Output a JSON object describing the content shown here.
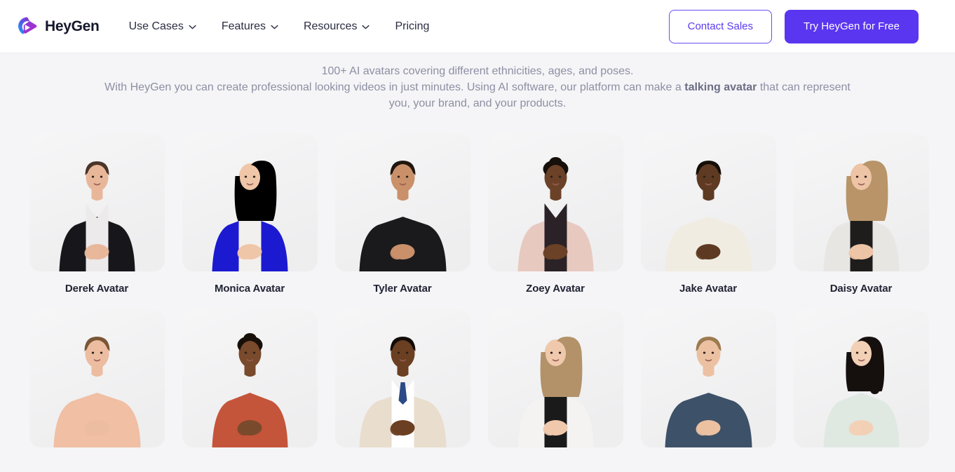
{
  "header": {
    "brand": {
      "name": "HeyGen",
      "logo_icon": "heygen-play-logo",
      "gradient_from": "#2f8bf5",
      "gradient_to": "#8b2bd6"
    },
    "nav": [
      {
        "label": "Use Cases",
        "has_dropdown": true,
        "icon": "chevron-down-icon"
      },
      {
        "label": "Features",
        "has_dropdown": true,
        "icon": "chevron-down-icon"
      },
      {
        "label": "Resources",
        "has_dropdown": true,
        "icon": "chevron-down-icon"
      },
      {
        "label": "Pricing",
        "has_dropdown": false
      }
    ],
    "actions": {
      "contact_sales": "Contact Sales",
      "try_free": "Try HeyGen for Free",
      "accent_color": "#5b36f0"
    }
  },
  "intro": {
    "line1": "100+ AI avatars covering different ethnicities, ages, and poses.",
    "line2_part1": "With HeyGen you can create professional looking videos in just minutes. Using AI software, our platform can make a ",
    "line2_bold": "talking avatar",
    "line2_part2": " that can represent you, your brand, and your products."
  },
  "avatars": [
    {
      "name": "Derek Avatar",
      "skin": "#e8b79a",
      "hair": "#4a3528",
      "outfit": "#17171b",
      "shirt": "#eceaea",
      "bg": "#f0f0f1",
      "hair_style": "short",
      "build": "slim"
    },
    {
      "name": "Monica Avatar",
      "skin": "#f0c6a8",
      "hair": "#c9a濃",
      "outfit": "#1c1ad0",
      "shirt": "#f2f0ee",
      "bg": "#f0f0f1",
      "hair_style": "long",
      "build": "slim"
    },
    {
      "name": "Tyler Avatar",
      "skin": "#c9906a",
      "hair": "#20160f",
      "outfit": "#1a1a1c",
      "shirt": "#1a1a1c",
      "bg": "#f0f0f1",
      "hair_style": "short",
      "build": "broad"
    },
    {
      "name": "Zoey Avatar",
      "skin": "#6b4228",
      "hair": "#160f0a",
      "outfit": "#e8c9c0",
      "shirt": "#2a2226",
      "bg": "#f0f0f1",
      "hair_style": "updo",
      "build": "slim"
    },
    {
      "name": "Jake Avatar",
      "skin": "#5e3a22",
      "hair": "#150e09",
      "outfit": "#f0ece2",
      "shirt": "#f0ece2",
      "bg": "#f0f0f1",
      "hair_style": "short",
      "build": "broad"
    },
    {
      "name": "Daisy Avatar",
      "skin": "#eec4a6",
      "hair": "#b89468",
      "outfit": "#e8e6e3",
      "shirt": "#1f1d1c",
      "bg": "#f0f0f1",
      "hair_style": "long",
      "build": "slim"
    },
    {
      "name": "",
      "skin": "#ecbda0",
      "hair": "#7a5636",
      "outfit": "#f0bfa4",
      "shirt": "#f0bfa4",
      "bg": "#f0f0f1",
      "hair_style": "short",
      "build": "broad"
    },
    {
      "name": "",
      "skin": "#7a4a2c",
      "hair": "#17100a",
      "outfit": "#c4553a",
      "shirt": "#c4553a",
      "bg": "#f0f0f1",
      "hair_style": "updo",
      "build": "slim"
    },
    {
      "name": "",
      "skin": "#6b3f22",
      "hair": "#120c08",
      "outfit": "#e9ddcd",
      "shirt": "#ffffff",
      "bg": "#f0f0f1",
      "hair_style": "short",
      "build": "broad",
      "tie": "#2b4a86"
    },
    {
      "name": "",
      "skin": "#f0c9ad",
      "hair": "#b3926a",
      "outfit": "#f4f3f1",
      "shirt": "#1a1a1a",
      "bg": "#f0f0f1",
      "hair_style": "long",
      "build": "slim"
    },
    {
      "name": "",
      "skin": "#ecc1a2",
      "hair": "#9c7b4f",
      "outfit": "#3d5168",
      "shirt": "#3d5168",
      "bg": "#f0f0f1",
      "hair_style": "short",
      "build": "broad"
    },
    {
      "name": "",
      "skin": "#f2d0b6",
      "hair": "#15100e",
      "outfit": "#dfe9e2",
      "shirt": "#dfe9e2",
      "bg": "#f0f0f1",
      "hair_style": "braid",
      "build": "slim"
    }
  ]
}
